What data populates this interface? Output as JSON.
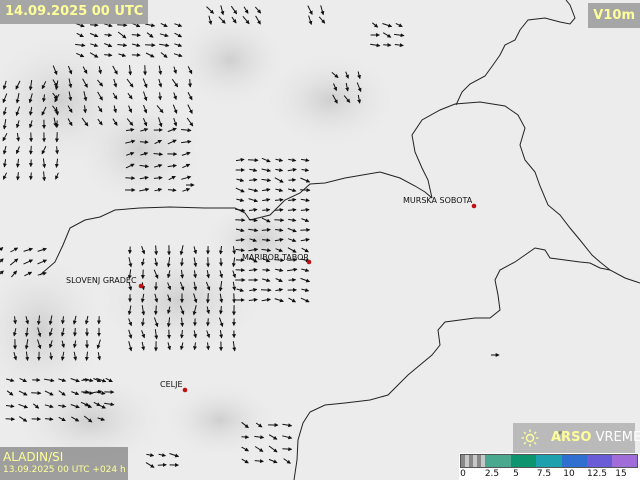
{
  "header": {
    "valid_time": "14.09.2025 00 UTC",
    "parameter": "V10m"
  },
  "footer": {
    "model": "ALADIN/SI",
    "run_info": "13.09.2025 00 UTC +024 h"
  },
  "brand": {
    "name_bold": "ARSO",
    "name_rest": " VREME",
    "icon": "sun-icon"
  },
  "legend": {
    "ticks": [
      "0",
      "2.5",
      "5",
      "7.5",
      "10",
      "12.5",
      "15"
    ],
    "colors": [
      "#b4b4b4",
      "#4aa88e",
      "#0f9470",
      "#1fa0ad",
      "#2f6fd0",
      "#6a5cd6",
      "#9f6cd8"
    ]
  },
  "cities": [
    {
      "name": "MURSKA SOBOTA"
    },
    {
      "name": "MARIBOR TABOR"
    },
    {
      "name": "SLOVENJ GRADEC"
    },
    {
      "name": "CELJE"
    }
  ],
  "colors": {
    "land": "#ececec",
    "border": "#222222",
    "city_dot": "#c01010",
    "badge_text": "#ffff9a"
  }
}
